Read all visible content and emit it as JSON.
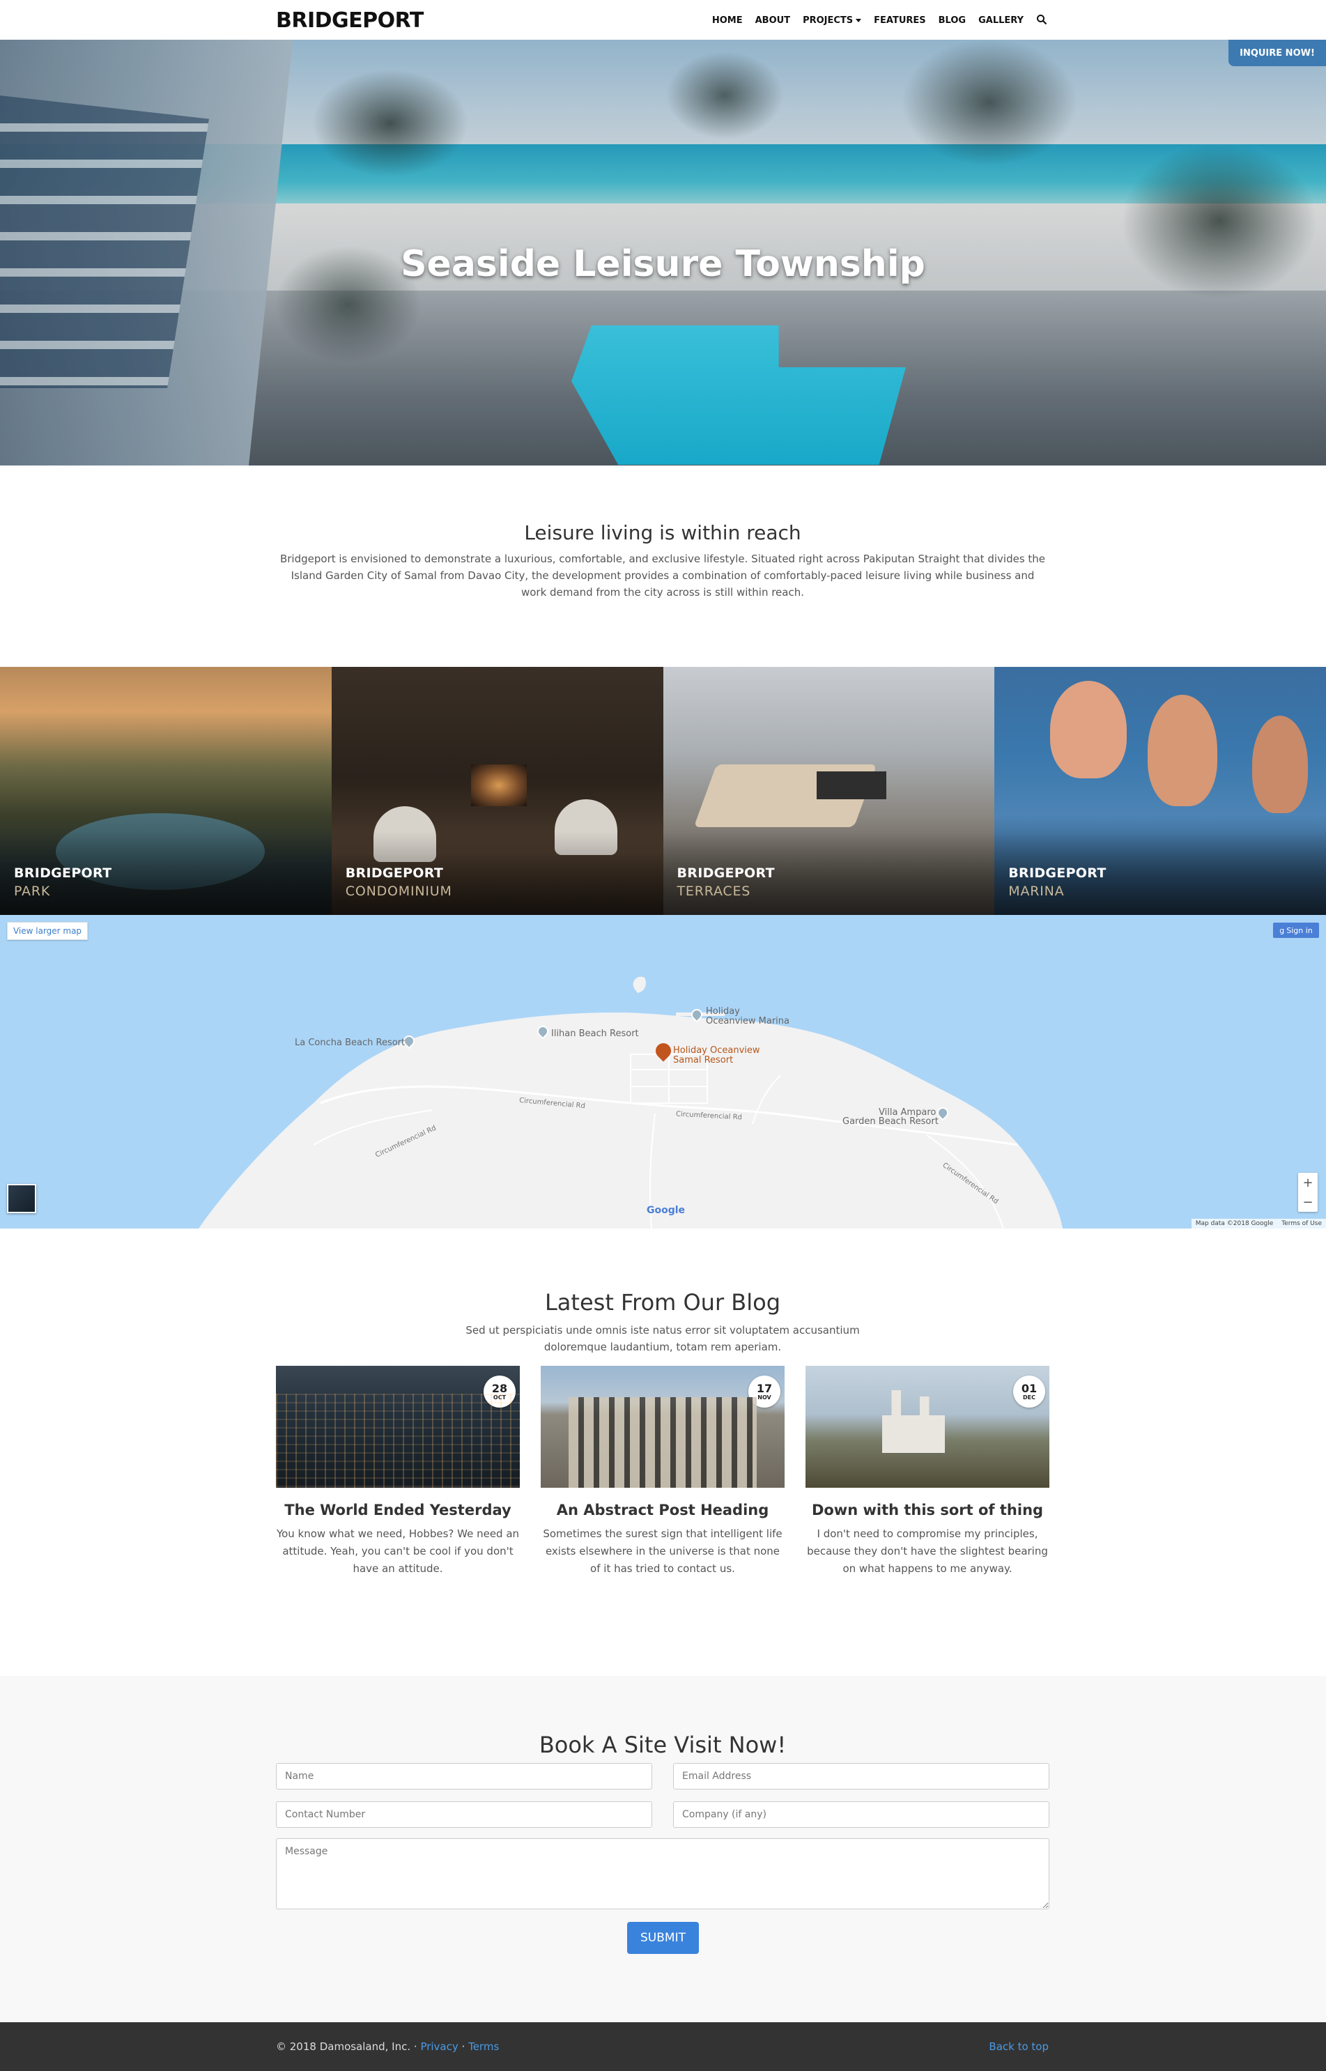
{
  "navbar": {
    "brand": "BRIDGEPORT",
    "items": [
      {
        "label": "HOME"
      },
      {
        "label": "ABOUT"
      },
      {
        "label": "PROJECTS"
      },
      {
        "label": "FEATURES"
      },
      {
        "label": "BLOG"
      },
      {
        "label": "GALLERY"
      }
    ]
  },
  "hero": {
    "title": "Seaside Leisure Township",
    "inquire_label": "INQUIRE NOW!",
    "slide_count": 3,
    "active_slide": 1
  },
  "intro": {
    "title": "Leisure living is within reach",
    "text": "Bridgeport is envisioned to demonstrate a luxurious, comfortable, and exclusive lifestyle. Situated right across Pakiputan Straight that divides the Island Garden City of Samal from Davao City, the development provides a combination of comfortably-paced leisure living while business and work demand from the city across is still within reach."
  },
  "projects": [
    {
      "title": "BRIDGEPORT",
      "subtitle": "PARK"
    },
    {
      "title": "BRIDGEPORT",
      "subtitle": "CONDOMINIUM"
    },
    {
      "title": "BRIDGEPORT",
      "subtitle": "TERRACES"
    },
    {
      "title": "BRIDGEPORT",
      "subtitle": "MARINA"
    }
  ],
  "map": {
    "view_larger": "View larger map",
    "sign_in": "Sign in",
    "labels": {
      "la_concha": "La Concha Beach Resort",
      "ilihan": "Ilihan Beach Resort",
      "marina_1": "Holiday",
      "marina_2": "Oceanview Marina",
      "samal_1": "Holiday Oceanview",
      "samal_2": "Samal Resort",
      "villa_1": "Villa Amparo",
      "villa_2": "Garden Beach Resort"
    },
    "roads": [
      "Circumferencial Rd",
      "Circumferencial Rd",
      "Circumferencial Rd",
      "Circumferencial Rd"
    ],
    "google": "Google",
    "map_data": "Map data ©2018 Google",
    "terms": "Terms of Use",
    "zoom_in": "+",
    "zoom_out": "−"
  },
  "blog": {
    "title": "Latest From Our Blog",
    "subtitle": "Sed ut perspiciatis unde omnis iste natus error sit voluptatem accusantium doloremque laudantium, totam rem aperiam.",
    "posts": [
      {
        "day": "28",
        "month": "OCT",
        "heading": "The World Ended Yesterday",
        "excerpt": "You know what we need, Hobbes? We need an attitude. Yeah, you can't be cool if you don't have an attitude."
      },
      {
        "day": "17",
        "month": "NOV",
        "heading": "An Abstract Post Heading",
        "excerpt": "Sometimes the surest sign that intelligent life exists elsewhere in the universe is that none of it has tried to contact us."
      },
      {
        "day": "01",
        "month": "DEC",
        "heading": "Down with this sort of thing",
        "excerpt": "I don't need to compromise my principles, because they don't have the slightest bearing on what happens to me anyway."
      }
    ]
  },
  "book": {
    "title": "Book A Site Visit Now!",
    "name_placeholder": "Name",
    "email_placeholder": "Email Address",
    "contact_placeholder": "Contact Number",
    "company_placeholder": "Company (if any)",
    "message_placeholder": "Message",
    "submit_label": "SUBMIT"
  },
  "footer": {
    "copyright": "© 2018 Damosaland, Inc. ·",
    "privacy": "Privacy",
    "sep": "·",
    "terms": "Terms",
    "back_to_top": "Back to top"
  },
  "colors": {
    "accent": "#3a83dd",
    "inquire_bg": "#3d7ab1",
    "footer_bg": "#333333",
    "map_water": "#abd5f7",
    "project_subtitle": "#c8b89a"
  }
}
